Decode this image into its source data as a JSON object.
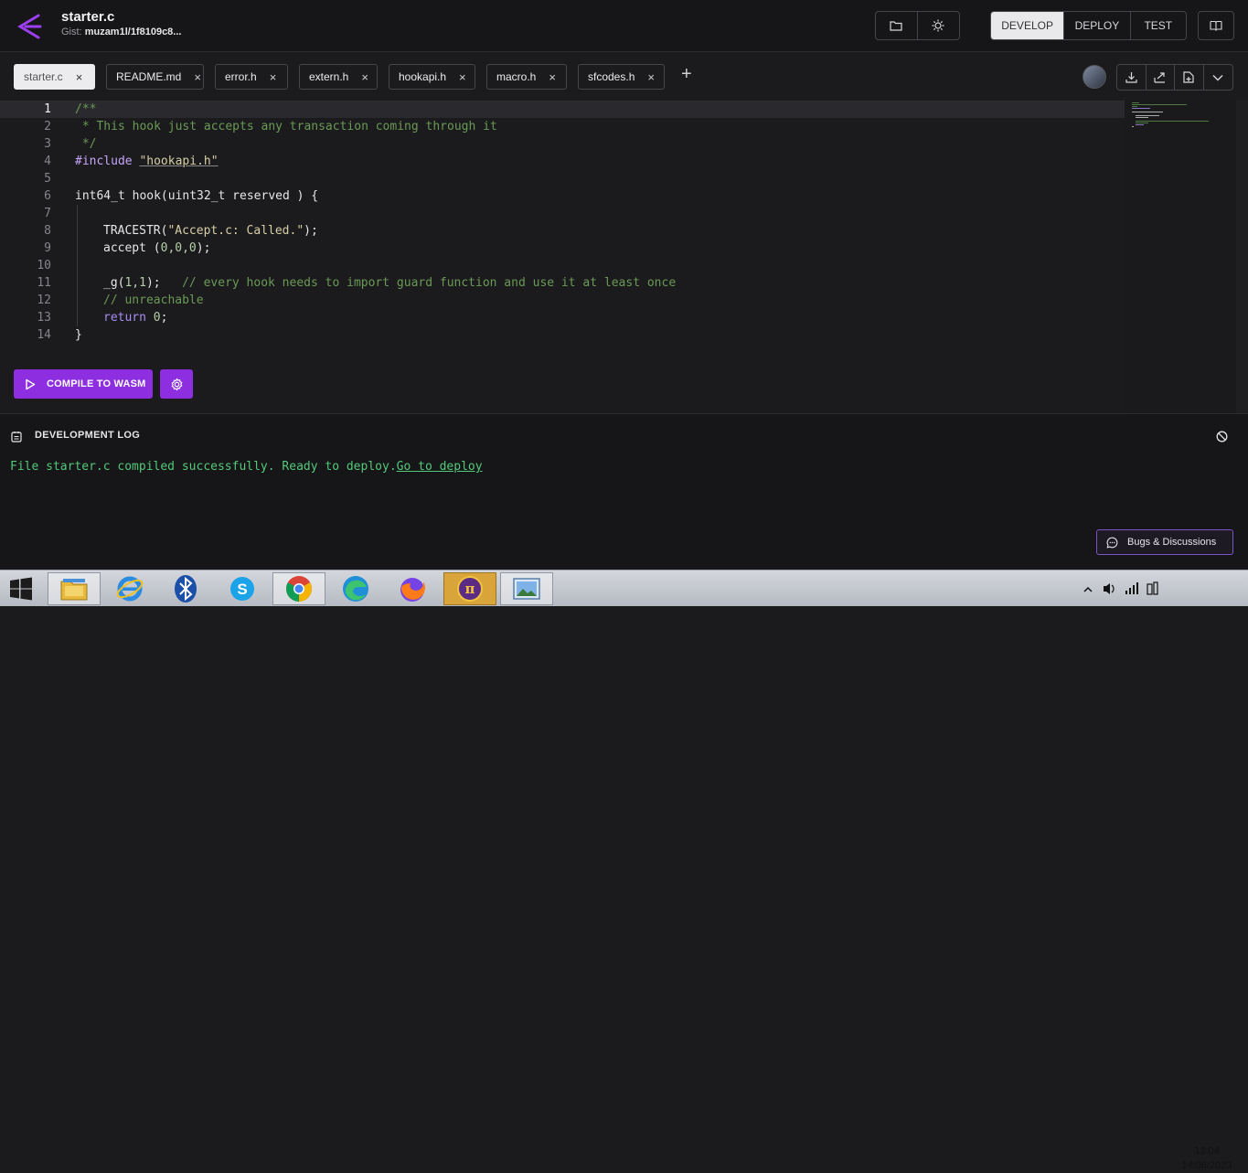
{
  "header": {
    "title": "starter.c",
    "gist_label": "Gist:",
    "gist_id": "muzam1l/1f8109c8...",
    "modes": [
      "DEVELOP",
      "DEPLOY",
      "TEST"
    ],
    "active_mode": "DEVELOP"
  },
  "tabs": [
    {
      "label": "starter.c",
      "active": true
    },
    {
      "label": "README.md",
      "active": false
    },
    {
      "label": "error.h",
      "active": false
    },
    {
      "label": "extern.h",
      "active": false
    },
    {
      "label": "hookapi.h",
      "active": false
    },
    {
      "label": "macro.h",
      "active": false
    },
    {
      "label": "sfcodes.h",
      "active": false
    }
  ],
  "editor": {
    "line_numbers": [
      "1",
      "2",
      "3",
      "4",
      "5",
      "6",
      "7",
      "8",
      "9",
      "10",
      "11",
      "12",
      "13",
      "14"
    ],
    "lines": {
      "l1": "/**",
      "l2": " * This hook just accepts any transaction coming through it",
      "l3": " */",
      "l4_kw": "#include",
      "l4_file": "\"hookapi.h\"",
      "l6_a": "int64_t hook(uint32_t reserved ) {",
      "l8_a": "TRACESTR(",
      "l8_str": "\"Accept.c: Called.\"",
      "l8_b": ");",
      "l9_a": "accept (",
      "l9_nums": "0,0,0",
      "l9_b": ");",
      "l11_a": "_g(",
      "l11_nums": "1,1",
      "l11_b": ");",
      "l11_comment": "// every hook needs to import guard function and use it at least once",
      "l12": "// unreachable",
      "l13_kw": "return",
      "l13_num": "0",
      "l13_b": ";",
      "l14": "}"
    },
    "current_line": 1
  },
  "actions": {
    "compile_label": "COMPILE TO WASM"
  },
  "devlog": {
    "title": "DEVELOPMENT LOG",
    "message": "File starter.c compiled successfully. Ready to deploy.",
    "link": "Go to deploy",
    "bugs_label": "Bugs & Discussions"
  },
  "taskbar": {
    "apps": [
      "start-icon",
      "file-explorer-icon",
      "internet-explorer-icon",
      "bluetooth-icon",
      "skype-icon",
      "chrome-icon",
      "edge-icon",
      "firefox-icon",
      "pi-browser-icon",
      "photos-icon"
    ],
    "time": "13:04",
    "date": "14/06/2023"
  },
  "colors": {
    "accent": "#8d2fe0",
    "comment": "#6a9955",
    "log_success": "#53c97a"
  }
}
